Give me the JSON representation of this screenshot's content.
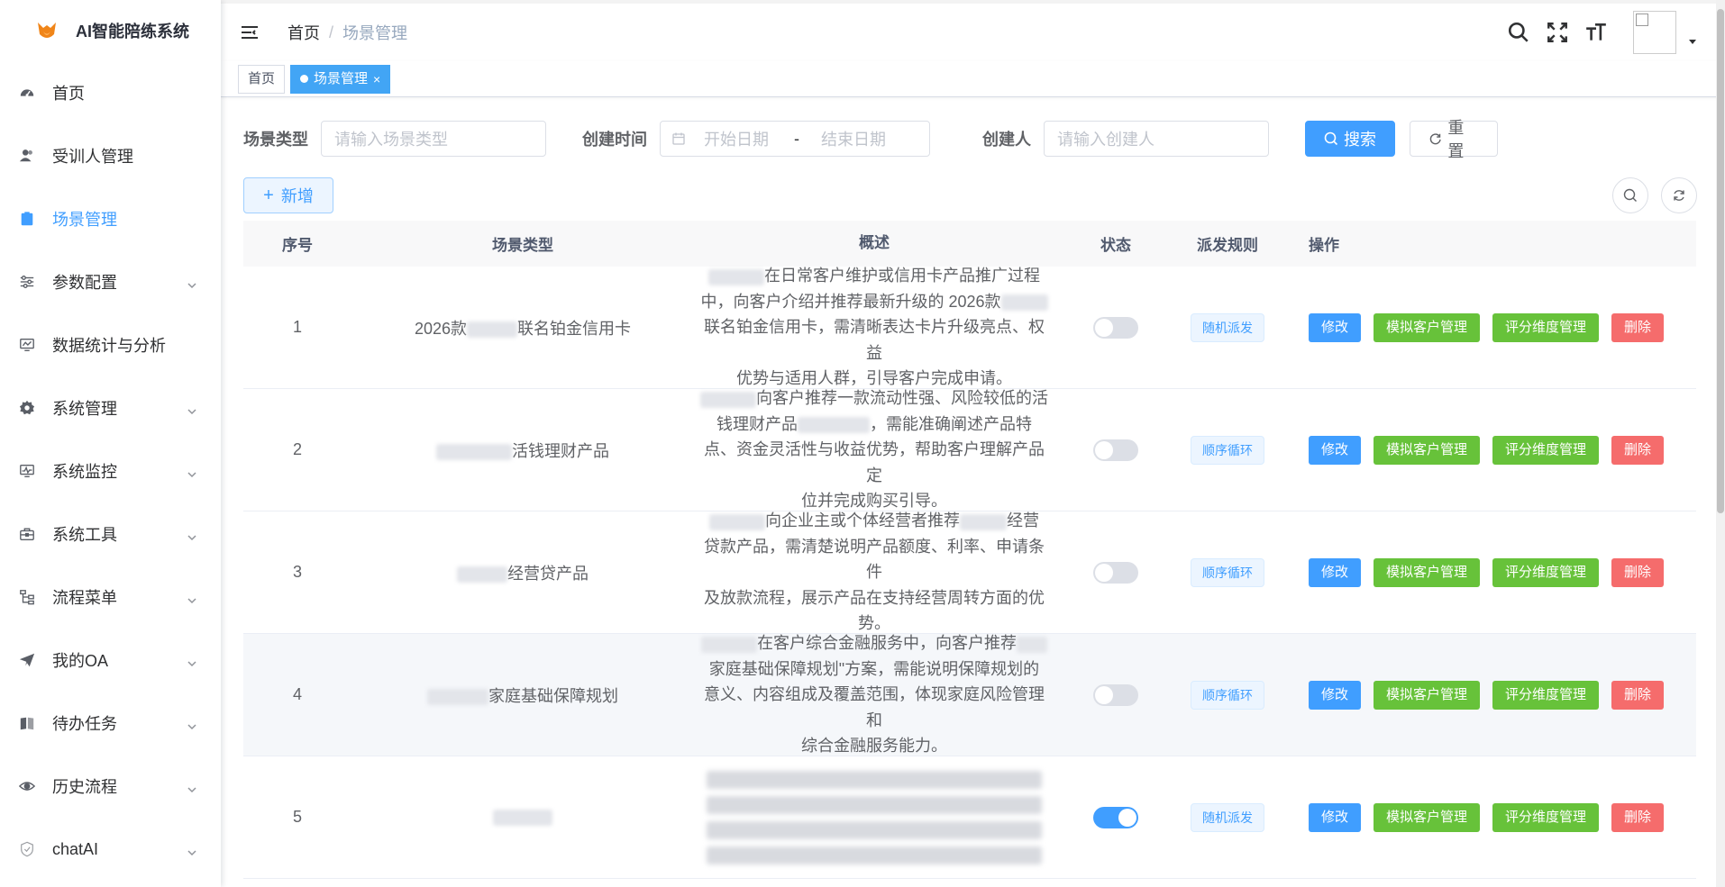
{
  "app": {
    "title": "AI智能陪练系统"
  },
  "sidebar": {
    "items": [
      {
        "label": "首页",
        "icon": "dashboard-icon",
        "has_arrow": false,
        "active": false
      },
      {
        "label": "受训人管理",
        "icon": "user-icon",
        "has_arrow": false,
        "active": false
      },
      {
        "label": "场景管理",
        "icon": "clipboard-icon",
        "has_arrow": false,
        "active": true
      },
      {
        "label": "参数配置",
        "icon": "sliders-icon",
        "has_arrow": true,
        "active": false
      },
      {
        "label": "数据统计与分析",
        "icon": "monitor-chart-icon",
        "has_arrow": false,
        "active": false
      },
      {
        "label": "系统管理",
        "icon": "gear-icon",
        "has_arrow": true,
        "active": false
      },
      {
        "label": "系统监控",
        "icon": "monitor-icon",
        "has_arrow": true,
        "active": false
      },
      {
        "label": "系统工具",
        "icon": "toolbox-icon",
        "has_arrow": true,
        "active": false
      },
      {
        "label": "流程菜单",
        "icon": "flow-icon",
        "has_arrow": true,
        "active": false
      },
      {
        "label": "我的OA",
        "icon": "paper-plane-icon",
        "has_arrow": true,
        "active": false
      },
      {
        "label": "待办任务",
        "icon": "book-icon",
        "has_arrow": true,
        "active": false
      },
      {
        "label": "历史流程",
        "icon": "eye-icon",
        "has_arrow": true,
        "active": false
      },
      {
        "label": "chatAI",
        "icon": "shield-icon",
        "has_arrow": true,
        "active": false
      }
    ]
  },
  "header": {
    "breadcrumb": {
      "home": "首页",
      "separator": "/",
      "current": "场景管理"
    }
  },
  "tags": {
    "home": "首页",
    "current": "场景管理",
    "close": "×"
  },
  "search": {
    "type_label": "场景类型",
    "type_placeholder": "请输入场景类型",
    "time_label": "创建时间",
    "start_placeholder": "开始日期",
    "range_sep": "-",
    "end_placeholder": "结束日期",
    "creator_label": "创建人",
    "creator_placeholder": "请输入创建人",
    "search_button": "搜索",
    "reset_button": "重置"
  },
  "toolbar": {
    "add_button": "新增",
    "add_plus": "+"
  },
  "table": {
    "headers": {
      "index": "序号",
      "type": "场景类型",
      "desc": "概述",
      "status": "状态",
      "rule": "派发规则",
      "ops": "操作"
    },
    "ops": {
      "edit": "修改",
      "customers": "模拟客户管理",
      "dimensions": "评分维度管理",
      "delete": "删除"
    },
    "rows": [
      {
        "index": "1",
        "type_prefix": "2026款",
        "type_suffix": "联名铂金信用卡",
        "desc_lines": [
          "在日常客户维护或信用卡产品推广过程",
          "中，向客户介绍并推荐最新升级的 2026款",
          "联名铂金信用卡，需清晰表达卡片升级亮点、权益",
          "优势与适用人群，引导客户完成申请。"
        ],
        "status_on": false,
        "rule": "随机派发"
      },
      {
        "index": "2",
        "type_prefix": "",
        "type_suffix": "活钱理财产品",
        "desc_lines": [
          "向客户推荐一款流动性强、风险较低的活",
          "钱理财产品",
          "，需能准确阐述产品特",
          "点、资金灵活性与收益优势，帮助客户理解产品定",
          "位并完成购买引导。"
        ],
        "status_on": false,
        "rule": "顺序循环"
      },
      {
        "index": "3",
        "type_prefix": "",
        "type_suffix": "经营贷产品",
        "desc_lines": [
          "向企业主或个体经营者推荐",
          "经营",
          "贷款产品，需清楚说明产品额度、利率、申请条件",
          "及放款流程，展示产品在支持经营周转方面的优",
          "势。"
        ],
        "status_on": false,
        "rule": "顺序循环"
      },
      {
        "index": "4",
        "type_prefix": "",
        "type_suffix": "家庭基础保障规划",
        "desc_lines": [
          "在客户综合金融服务中，向客户推荐",
          "家庭基础保障规划\"方案，需能说明保障规划的",
          "意义、内容组成及覆盖范围，体现家庭风险管理和",
          "综合金融服务能力。"
        ],
        "status_on": false,
        "rule": "顺序循环"
      },
      {
        "index": "5",
        "type_prefix": "",
        "type_suffix": "",
        "desc_lines": [],
        "status_on": true,
        "rule": "随机派发"
      }
    ]
  }
}
